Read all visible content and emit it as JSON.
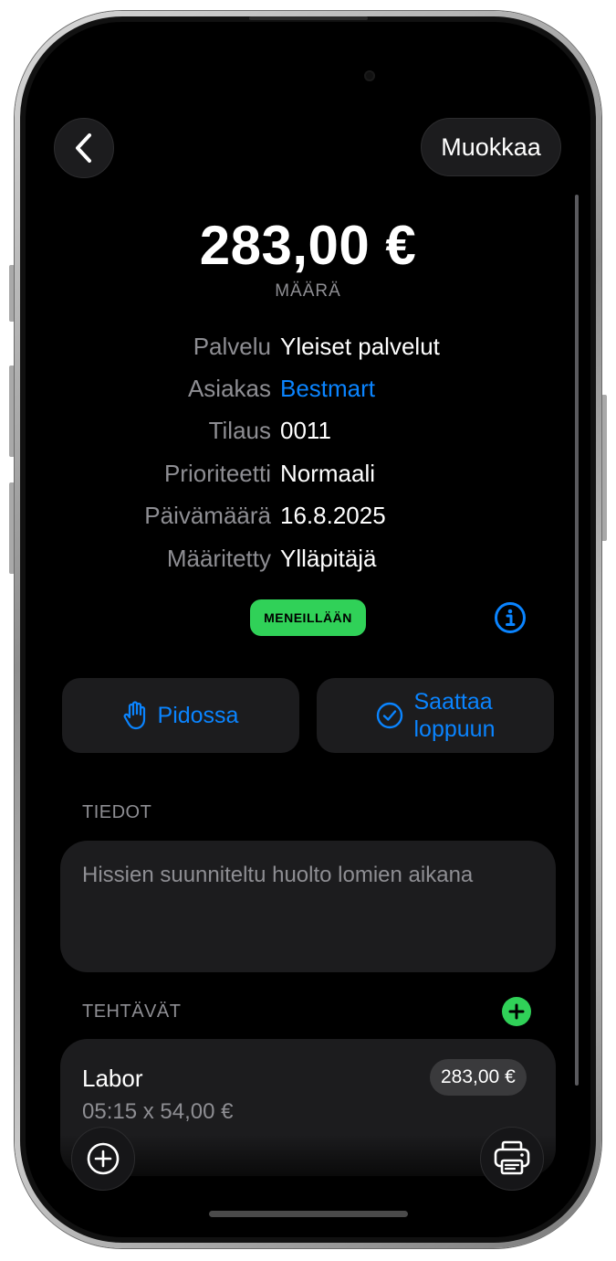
{
  "header": {
    "edit_label": "Muokkaa"
  },
  "summary": {
    "amount": "283,00 €",
    "amount_label": "MÄÄRÄ"
  },
  "details": [
    {
      "label": "Palvelu",
      "value": "Yleiset palvelut",
      "link": false
    },
    {
      "label": "Asiakas",
      "value": "Bestmart",
      "link": true
    },
    {
      "label": "Tilaus",
      "value": "0011",
      "link": false
    },
    {
      "label": "Prioriteetti",
      "value": "Normaali",
      "link": false
    },
    {
      "label": "Päivämäärä",
      "value": "16.8.2025",
      "link": false
    },
    {
      "label": "Määritetty",
      "value": "Ylläpitäjä",
      "link": false
    }
  ],
  "status": {
    "label": "MENEILLÄÄN",
    "color": "#30d158"
  },
  "actions": {
    "hold_label": "Pidossa",
    "complete_label_line1": "Saattaa",
    "complete_label_line2": "loppuun"
  },
  "notes": {
    "section_label": "TIEDOT",
    "text": "Hissien suunniteltu huolto lomien aikana"
  },
  "tasks": {
    "section_label": "TEHTÄVÄT",
    "items": [
      {
        "title": "Labor",
        "detail": "05:15 x 54,00 €",
        "price": "283,00 €"
      }
    ]
  },
  "colors": {
    "accent": "#0a84ff",
    "success": "#30d158",
    "background": "#000000",
    "card": "#1c1c1e"
  },
  "icons": [
    "back-chevron-icon",
    "info-icon",
    "hand-raised-icon",
    "checkmark-circle-icon",
    "plus-icon",
    "plus-circle-icon",
    "printer-icon"
  ]
}
